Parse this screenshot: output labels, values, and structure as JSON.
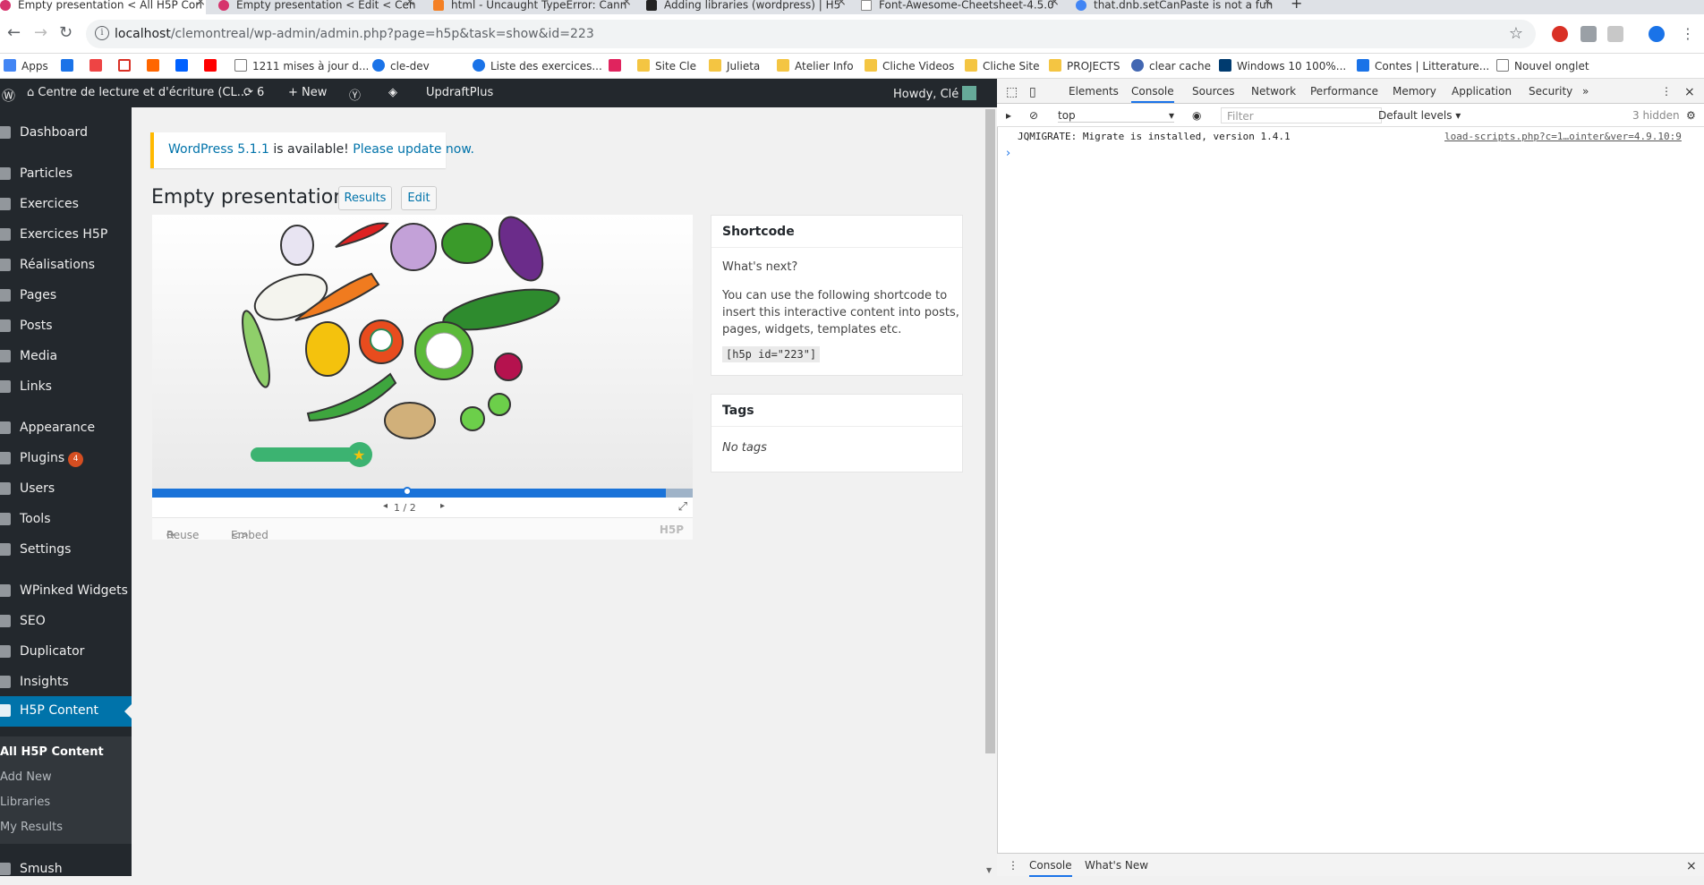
{
  "browser": {
    "tabs": [
      {
        "title": "Empty presentation < All H5P Con",
        "active": true
      },
      {
        "title": "Empty presentation < Edit < Centr"
      },
      {
        "title": "html - Uncaught TypeError: Cann"
      },
      {
        "title": "Adding libraries (wordpress) | H5"
      },
      {
        "title": "Font-Awesome-Cheetsheet-4.5.0"
      },
      {
        "title": "that.dnb.setCanPaste is not a fun"
      }
    ],
    "url_host": "localhost",
    "url_path": "/clemontreal/wp-admin/admin.php?page=h5p&task=show&id=223",
    "bookmarks": [
      "Apps",
      "1211 mises à jour d...",
      "cle-dev",
      "Liste des exercices...",
      "Site Cle",
      "Julieta",
      "Atelier Info",
      "Cliche Videos",
      "Cliche Site",
      "PROJECTS",
      "clear cache",
      "Windows 10 100%...",
      "Contes | Litterature...",
      "Nouvel onglet"
    ]
  },
  "wpbar": {
    "site_name": "Centre de lecture et d'écriture (CL...",
    "updates": "6",
    "new_label": "New",
    "plugin_label": "UpdraftPlus",
    "howdy": "Howdy, Clé"
  },
  "sidebar": {
    "items": [
      "Dashboard",
      "Particles",
      "Exercices",
      "Exercices H5P",
      "Réalisations",
      "Pages",
      "Posts",
      "Media",
      "Links",
      "Appearance",
      "Plugins",
      "Users",
      "Tools",
      "Settings",
      "WPinked Widgets",
      "SEO",
      "Duplicator",
      "Insights",
      "H5P Content",
      "Smush"
    ],
    "plugins_badge": "4",
    "submenu": [
      "All H5P Content",
      "Add New",
      "Libraries",
      "My Results"
    ]
  },
  "notice": {
    "version_link": "WordPress 5.1.1",
    "middle": " is available! ",
    "update_link": "Please update now."
  },
  "page": {
    "title": "Empty presentation",
    "results_btn": "Results",
    "edit_btn": "Edit"
  },
  "h5p": {
    "slide": "1 / 2",
    "reuse": "Reuse",
    "embed": "Embed",
    "logo": "H5P"
  },
  "shortcode_box": {
    "title": "Shortcode",
    "next": "What's next?",
    "desc_line1": "You can use the following shortcode to",
    "desc_line2": "insert this interactive content into posts,",
    "desc_line3": "pages, widgets, templates etc.",
    "code": "[h5p id=\"223\"]"
  },
  "tags_box": {
    "title": "Tags",
    "empty": "No tags"
  },
  "devtools": {
    "tabs": [
      "Elements",
      "Console",
      "Sources",
      "Network",
      "Performance",
      "Memory",
      "Application",
      "Security"
    ],
    "context": "top",
    "filter_placeholder": "Filter",
    "levels": "Default levels ▾",
    "hidden": "3 hidden",
    "log": "JQMIGRATE: Migrate is installed, version 1.4.1",
    "log_src": "load-scripts.php?c=1…ointer&ver=4.9.10:9",
    "drawer_tabs": [
      "Console",
      "What's New"
    ]
  },
  "colors": {
    "wp_dark": "#23282d",
    "wp_blue": "#0073aa",
    "notice_warning": "#ffb900",
    "progress": "#1a73d9"
  }
}
